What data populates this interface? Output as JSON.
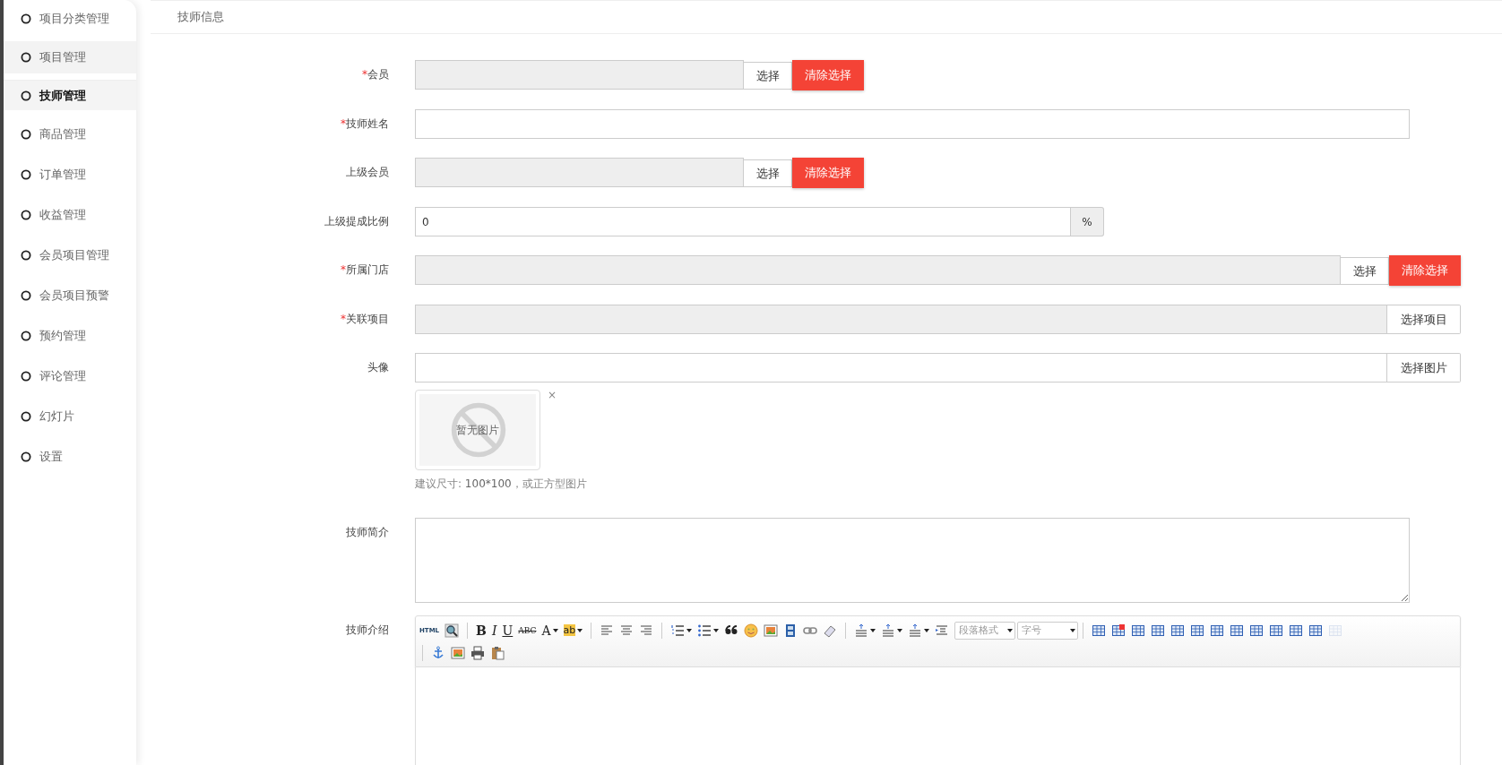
{
  "sidebar": {
    "items": [
      {
        "label": "项目分类管理",
        "selected": false,
        "highlighted": false
      },
      {
        "label": "项目管理",
        "selected": false,
        "highlighted": true
      },
      {
        "label": "技师管理",
        "selected": true,
        "highlighted": false
      },
      {
        "label": "商品管理",
        "selected": false,
        "highlighted": false
      },
      {
        "label": "订单管理",
        "selected": false,
        "highlighted": false
      },
      {
        "label": "收益管理",
        "selected": false,
        "highlighted": false
      },
      {
        "label": "会员项目管理",
        "selected": false,
        "highlighted": false
      },
      {
        "label": "会员项目预警",
        "selected": false,
        "highlighted": false
      },
      {
        "label": "预约管理",
        "selected": false,
        "highlighted": false
      },
      {
        "label": "评论管理",
        "selected": false,
        "highlighted": false
      },
      {
        "label": "幻灯片",
        "selected": false,
        "highlighted": false
      },
      {
        "label": "设置",
        "selected": false,
        "highlighted": false
      }
    ]
  },
  "panel": {
    "title": "技师信息"
  },
  "form": {
    "rows": [
      {
        "kind": "select",
        "label": "会员",
        "required_mark": "*",
        "wide": false,
        "choose_button": "选择",
        "clear_button": "清除选择"
      },
      {
        "kind": "text",
        "label": "技师姓名",
        "required_mark": "*",
        "value": ""
      },
      {
        "kind": "select",
        "label": "上级会员",
        "wide": false,
        "choose_button": "选择",
        "clear_button": "清除选择"
      },
      {
        "kind": "addon",
        "label": "上级提成比例",
        "value": "0",
        "addon": "%"
      },
      {
        "kind": "select",
        "label": "所属门店",
        "required_mark": "*",
        "wide": true,
        "choose_button": "选择",
        "clear_button": "清除选择"
      },
      {
        "kind": "picker",
        "label": "关联项目",
        "required_mark": "*",
        "button": "选择项目"
      },
      {
        "kind": "image",
        "label": "头像",
        "button": "选择图片",
        "preview_text": "暂无图片",
        "remove": "×",
        "hint": "建议尺寸: **100*100**，或正方型图片"
      },
      {
        "kind": "textarea",
        "label": "技师简介",
        "value": ""
      },
      {
        "kind": "editor",
        "label": "技师介绍",
        "toolbar": [
          [
            {
              "kind": "text",
              "label": "HTML"
            },
            {
              "kind": "icon"
            },
            {
              "kind": "sep"
            },
            {
              "kind": "bold",
              "label": "B"
            },
            {
              "kind": "italic",
              "label": "I"
            },
            {
              "kind": "underline",
              "label": "U"
            },
            {
              "kind": "strike",
              "label": "ABC"
            },
            {
              "kind": "text",
              "label": "A"
            },
            {
              "kind": "caret"
            },
            {
              "kind": "highlight",
              "label": "ab"
            },
            {
              "kind": "caret"
            },
            {
              "kind": "sep"
            },
            {
              "kind": "icon"
            },
            {
              "kind": "icon"
            },
            {
              "kind": "icon"
            },
            {
              "kind": "sep"
            },
            {
              "kind": "icon"
            },
            {
              "kind": "caret"
            },
            {
              "kind": "icon"
            },
            {
              "kind": "caret"
            },
            {
              "kind": "icon"
            },
            {
              "kind": "icon"
            },
            {
              "kind": "icon"
            },
            {
              "kind": "icon"
            },
            {
              "kind": "icon"
            },
            {
              "kind": "icon"
            },
            {
              "kind": "sep"
            },
            {
              "kind": "icon"
            },
            {
              "kind": "caret"
            },
            {
              "kind": "icon"
            },
            {
              "kind": "caret"
            },
            {
              "kind": "icon"
            },
            {
              "kind": "caret"
            },
            {
              "kind": "icon"
            },
            {
              "kind": "dropdown",
              "label": "段落格式"
            },
            {
              "kind": "dropdown",
              "label": "字号"
            },
            {
              "kind": "sep"
            },
            {
              "kind": "icon"
            },
            {
              "kind": "icon"
            },
            {
              "kind": "icon"
            },
            {
              "kind": "icon"
            },
            {
              "kind": "icon"
            },
            {
              "kind": "icon"
            },
            {
              "kind": "icon"
            },
            {
              "kind": "icon"
            },
            {
              "kind": "icon"
            },
            {
              "kind": "icon"
            },
            {
              "kind": "icon"
            },
            {
              "kind": "icon"
            },
            {
              "kind": "icon"
            }
          ],
          [
            {
              "kind": "sep"
            },
            {
              "kind": "icon"
            },
            {
              "kind": "icon"
            },
            {
              "kind": "icon"
            },
            {
              "kind": "icon"
            }
          ]
        ]
      }
    ]
  }
}
